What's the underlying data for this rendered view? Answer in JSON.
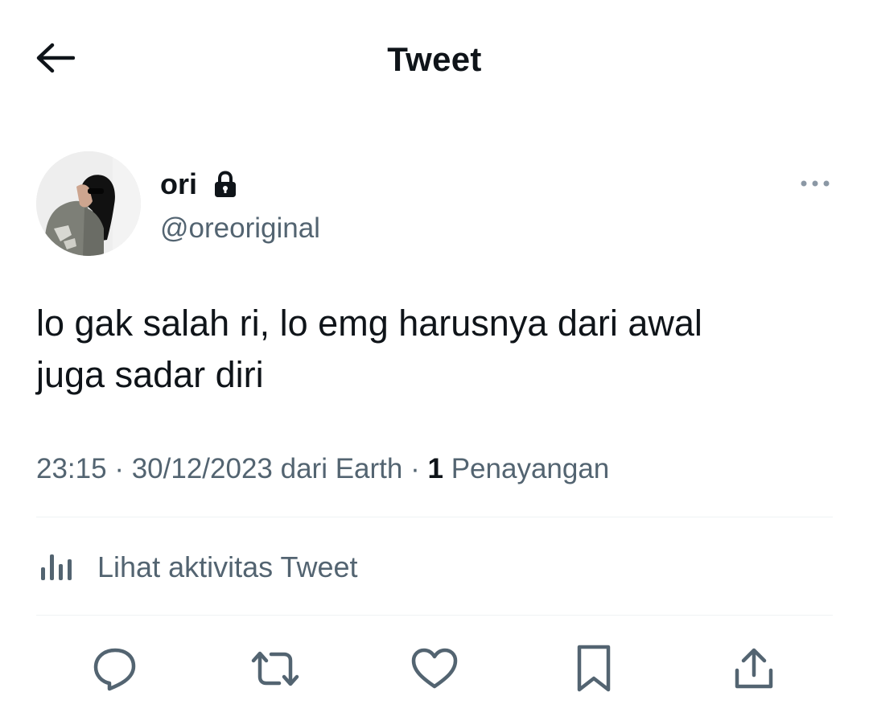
{
  "header": {
    "title": "Tweet",
    "back_icon": "arrow-left-icon"
  },
  "author": {
    "display_name": "ori",
    "handle": "@oreoriginal",
    "protected_icon": "lock-icon",
    "more_icon": "more-horizontal-icon"
  },
  "tweet": {
    "text_line_1": "lo gak salah ri, lo emg harusnya dari awal",
    "text_line_2": "juga sadar diri"
  },
  "meta": {
    "time": "23:15",
    "separator": "·",
    "date": "30/12/2023",
    "source": "dari Earth",
    "views_count": "1",
    "views_label": "Penayangan"
  },
  "activity": {
    "label": "Lihat aktivitas Tweet",
    "icon": "analytics-bars-icon"
  },
  "actions": [
    {
      "icon": "reply-icon"
    },
    {
      "icon": "retweet-icon"
    },
    {
      "icon": "like-heart-icon"
    },
    {
      "icon": "bookmark-icon"
    },
    {
      "icon": "share-icon"
    }
  ],
  "colors": {
    "text_primary": "#0f1419",
    "text_secondary": "#536471",
    "divider": "#eff3f4",
    "background": "#ffffff"
  }
}
